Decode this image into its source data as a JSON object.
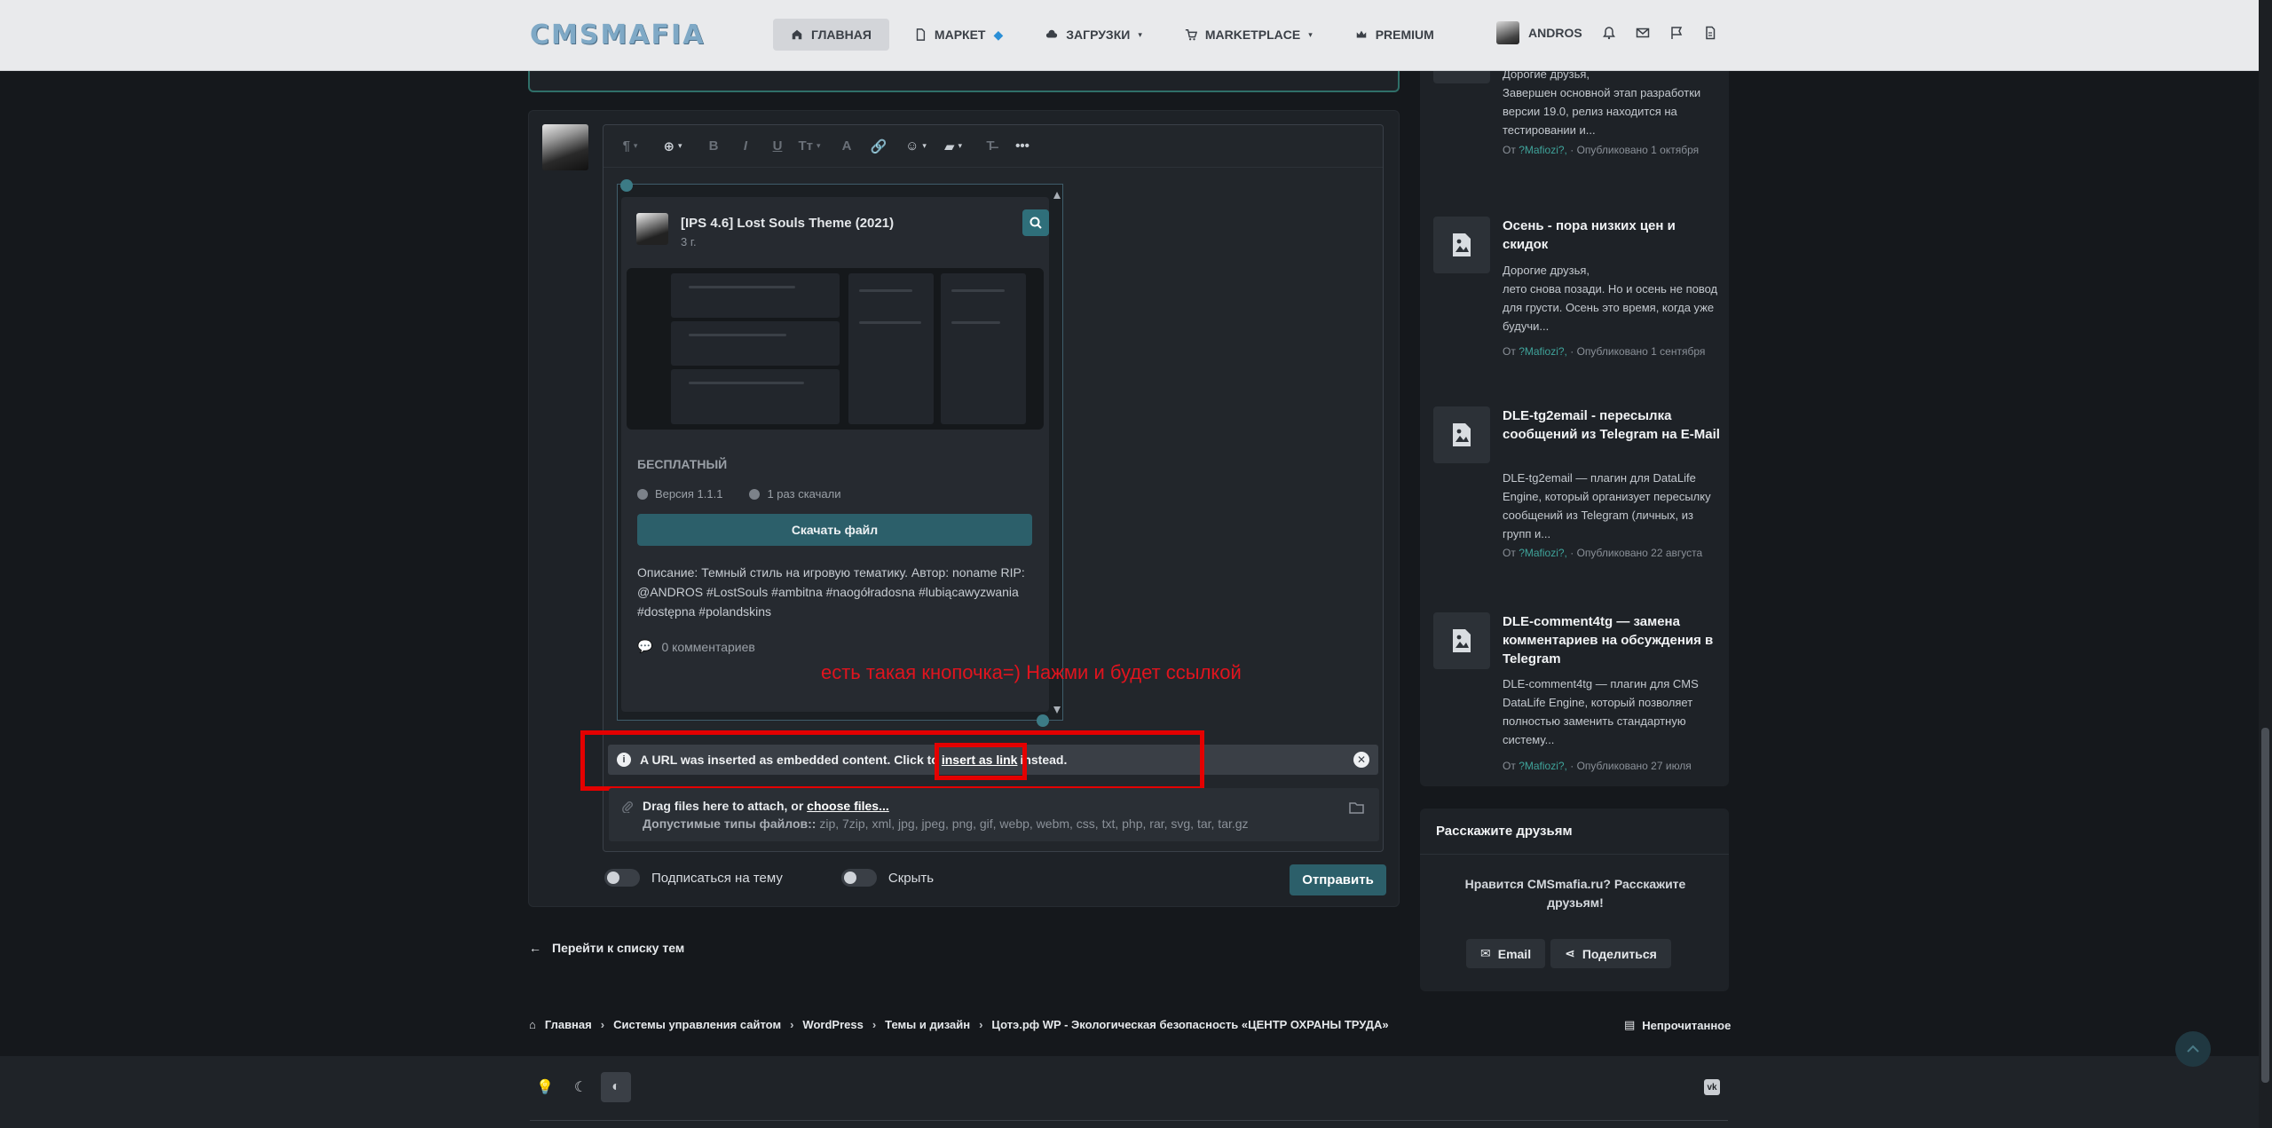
{
  "header": {
    "logo": "CMSMAFIA",
    "nav": [
      {
        "label": "Главная",
        "icon": "home-icon"
      },
      {
        "label": "Маркет",
        "icon": "file-icon"
      },
      {
        "label": "Загрузки",
        "icon": "cloud-icon"
      },
      {
        "label": "Marketplace",
        "icon": "cart-icon"
      },
      {
        "label": "Premium",
        "icon": "crown-icon"
      }
    ],
    "user_name": "ANDROS"
  },
  "editor": {
    "embed": {
      "title": "[IPS 4.6] Lost Souls Theme (2021)",
      "time": "3 г.",
      "badge": "БЕСПЛАТНЫЙ",
      "version": "Версия 1.1.1",
      "downloads": "1 раз скачали",
      "download_button": "Скачать файл",
      "description": "Описание: Темный стиль на игровую тематику. Автор: noname RIP: @ANDROS #LostSouls #ambitna #naogółradosna #lubiącawyzwania #dostępna #polandskins",
      "comments": "0 комментариев"
    },
    "annotation": "есть такая кнопочка=) Нажми и будет ссылкой",
    "notice": {
      "before": "A URL was inserted as embedded content. Click to",
      "link": "insert as link",
      "after": "instead."
    },
    "attach": {
      "line1": "Drag files here to attach, or",
      "choose": "choose files...",
      "types_label": "Допустимые типы файлов::",
      "types": "zip, 7zip, xml, jpg, jpeg, png, gif, webp, webm, css, txt, php, rar, svg, tar, tar.gz"
    },
    "subscribe_label": "Подписаться на тему",
    "hide_label": "Скрыть",
    "submit_label": "Отправить"
  },
  "back_link": "Перейти к списку тем",
  "breadcrumb": [
    "Главная",
    "Системы управления сайтом",
    "WordPress",
    "Темы и дизайн",
    "Цотэ.рф WP - Экологическая безопасность «ЦЕНТР ОХРАНЫ ТРУДА»"
  ],
  "unread_label": "Непрочитанное",
  "sidebar": {
    "items": [
      {
        "title": "",
        "body": "Дорогие друзья,\nЗавершен основной этап разработки версии 19.0, релиз находится на тестировании и...",
        "author": "?Mafiozi?,",
        "meta_prefix": "От",
        "meta_suffix": "· Опубликовано 1 октября"
      },
      {
        "title": "Осень - пора низких цен и скидок",
        "body": "Дорогие друзья,\nлето снова позади. Но и осень не повод для грусти. Осень это время, когда уже будучи...",
        "author": "?Mafiozi?,",
        "meta_prefix": "От",
        "meta_suffix": "· Опубликовано 1 сентября"
      },
      {
        "title": "DLE-tg2email - пересылка сообщений из Telegram на E-Mail",
        "body": "DLE-tg2email — плагин для DataLife Engine, который организует пересылку сообщений из Telegram (личных, из групп и...",
        "author": "?Mafiozi?,",
        "meta_prefix": "От",
        "meta_suffix": "· Опубликовано 22 августа"
      },
      {
        "title": "DLE-comment4tg — замена комментариев на обсуждения в Telegram",
        "body": "DLE-comment4tg — плагин для CMS DataLife Engine, который позволяет полностью заменить стандартную систему...",
        "author": "?Mafiozi?,",
        "meta_prefix": "От",
        "meta_suffix": "· Опубликовано 27 июля"
      }
    ],
    "share": {
      "title": "Расскажите друзьям",
      "text": "Нравится CMSmafia.ru? Расскажите друзьям!",
      "email_label": "Email",
      "share_label": "Поделиться"
    }
  },
  "footer": {
    "vk": "vk"
  },
  "colors": {
    "accent": "#2c5f6a",
    "annotation_red": "#e40000",
    "link_teal": "#3fa39a"
  }
}
